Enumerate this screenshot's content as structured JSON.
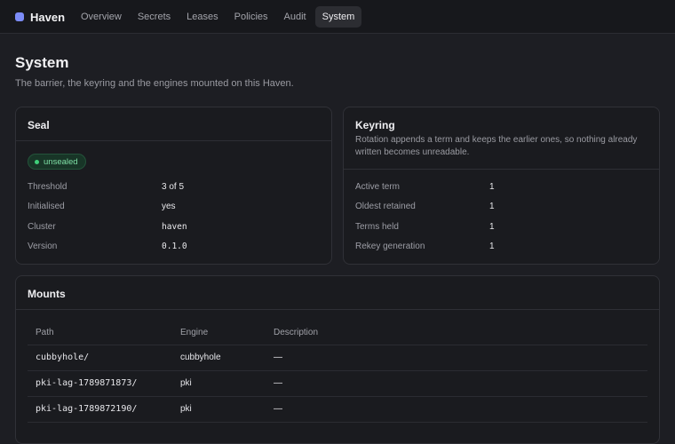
{
  "app": {
    "name": "Haven",
    "brand_color": "#7c8cf8"
  },
  "nav": {
    "tabs": [
      {
        "label": "Overview"
      },
      {
        "label": "Secrets"
      },
      {
        "label": "Leases"
      },
      {
        "label": "Policies"
      },
      {
        "label": "Audit"
      },
      {
        "label": "System"
      }
    ],
    "active": "System"
  },
  "page": {
    "title": "System",
    "subtitle": "The barrier, the keyring and the engines mounted on this Haven."
  },
  "seal": {
    "title": "Seal",
    "status": "unsealed",
    "status_color": "#3fd07a",
    "rows": [
      {
        "key": "Threshold",
        "value": "3 of 5"
      },
      {
        "key": "Initialised",
        "value": "yes"
      },
      {
        "key": "Cluster",
        "value": "haven"
      },
      {
        "key": "Version",
        "value": "0.1.0"
      }
    ]
  },
  "keyring": {
    "title": "Keyring",
    "description": "Rotation appends a term and keeps the earlier ones, so nothing already written becomes unreadable.",
    "rows": [
      {
        "key": "Active term",
        "value": "1"
      },
      {
        "key": "Oldest retained",
        "value": "1"
      },
      {
        "key": "Terms held",
        "value": "1"
      },
      {
        "key": "Rekey generation",
        "value": "1"
      }
    ]
  },
  "mounts": {
    "title": "Mounts",
    "columns": [
      "Path",
      "Engine",
      "Description"
    ],
    "rows": [
      {
        "path": "cubbyhole/",
        "engine": "cubbyhole",
        "description": "—"
      },
      {
        "path": "pki-lag-1789871873/",
        "engine": "pki",
        "description": "—"
      },
      {
        "path": "pki-lag-1789872190/",
        "engine": "pki",
        "description": "—"
      }
    ]
  }
}
